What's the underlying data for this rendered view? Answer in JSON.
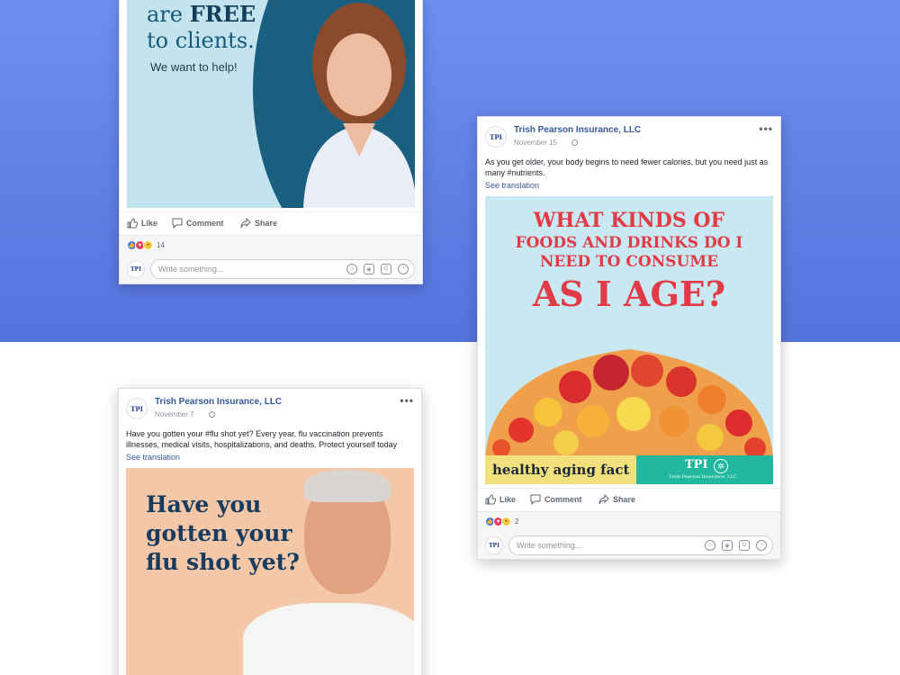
{
  "page_name": "Trish Pearson Insurance, LLC",
  "logo_text": "TPI",
  "more_glyph": "•••",
  "see_translation": "See translation",
  "actions": {
    "like": "Like",
    "comment": "Comment",
    "share": "Share"
  },
  "comment_placeholder": "Write something...",
  "colors": {
    "background_top": "#6e8ff0",
    "link_blue": "#365899",
    "headline_red": "#e23b48",
    "headline_navy": "#173c5e"
  },
  "card1": {
    "image_line1_pre": "are ",
    "image_line1_bold": "FREE",
    "image_line2": "to clients.",
    "image_line3": "We want to help!",
    "reaction_count": "14"
  },
  "card2": {
    "date": "November 15",
    "text": "As you get older, your body begins to need fewer calories, but you need just as many #nutrients.",
    "headline": [
      "WHAT KINDS OF",
      "FOODS AND DRINKS DO I",
      "NEED TO CONSUME",
      "AS I AGE?"
    ],
    "banner_left": "healthy aging fact",
    "banner_logo": "TPI",
    "banner_company": "Trish Pearson Insurance, LLC",
    "reaction_count": "2"
  },
  "card3": {
    "date": "November 7",
    "text": "Have you gotten your #flu shot yet? Every year, flu vaccination prevents illnesses, medical visits, hospitalizations, and deaths. Protect yourself today",
    "headline": [
      "Have you",
      "gotten your",
      "flu shot yet?"
    ]
  }
}
